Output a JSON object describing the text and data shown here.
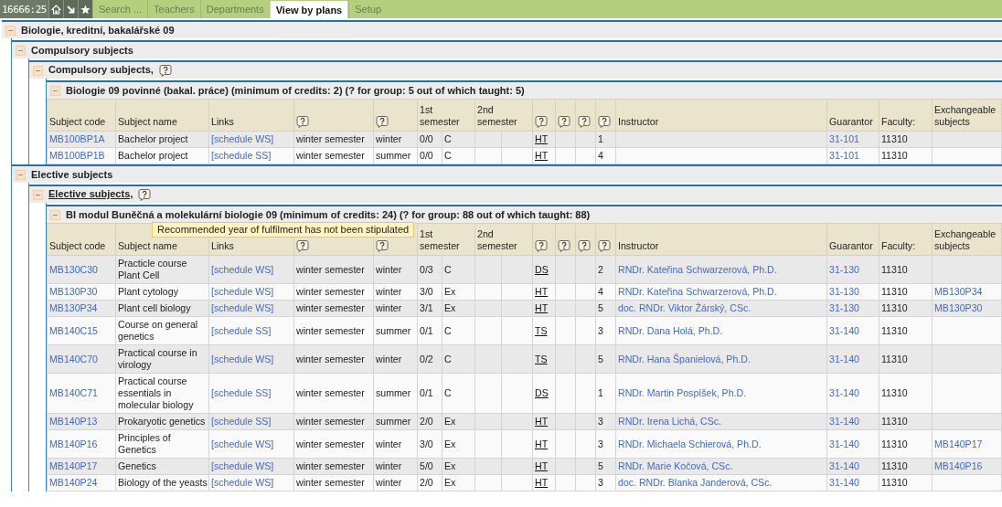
{
  "top_bar": {
    "counter": "16666:25",
    "tabs": [
      {
        "label": "Search ...",
        "selected": false
      },
      {
        "label": "Teachers",
        "selected": false
      },
      {
        "label": "Departments",
        "selected": false
      },
      {
        "label": "View by plans",
        "selected": true
      },
      {
        "label": "Setup",
        "selected": false
      }
    ]
  },
  "plan": {
    "title": "Biologie, kreditní, bakalářské 09",
    "expanded": true,
    "help": false,
    "hovered": false,
    "children": [
      {
        "title": "Compulsory subjects",
        "expanded": true,
        "help": false,
        "hovered": false,
        "children": [
          {
            "title": "Compulsory subjects,",
            "expanded": true,
            "help": true,
            "hovered": false,
            "children": [
              {
                "title": "Biologie 09 povinné (bakal. práce) (minimum of credits: 2) (? for group: 5 out of which taught: 5)",
                "expanded": true,
                "help": false,
                "hovered": false,
                "table": {
                  "columns": [
                    {
                      "kind": "text",
                      "label": "Subject code"
                    },
                    {
                      "kind": "text",
                      "label": "Subject name"
                    },
                    {
                      "kind": "text",
                      "label": "Links"
                    },
                    {
                      "kind": "help"
                    },
                    {
                      "kind": "help"
                    },
                    {
                      "kind": "pair",
                      "label": "1st semester"
                    },
                    {
                      "kind": "pair",
                      "label": "2nd semester"
                    },
                    {
                      "kind": "help"
                    },
                    {
                      "kind": "help"
                    },
                    {
                      "kind": "help"
                    },
                    {
                      "kind": "help"
                    },
                    {
                      "kind": "text",
                      "label": "Instructor"
                    },
                    {
                      "kind": "text",
                      "label": "Guarantor"
                    },
                    {
                      "kind": "text",
                      "label": "Faculty:"
                    },
                    {
                      "kind": "text",
                      "label": "Exchangeable subjects"
                    }
                  ],
                  "rows": [
                    {
                      "code": "MB100BP1A",
                      "name": "Bachelor project",
                      "links": "[schedule WS]",
                      "semester": "winter semester",
                      "period": "winter",
                      "hours": "0/0",
                      "completion": "C",
                      "type": "HT",
                      "year": "1",
                      "guarantor": "31-101",
                      "faculty": "11310"
                    },
                    {
                      "code": "MB100BP1B",
                      "name": "Bachelor project",
                      "links": "[schedule SS]",
                      "semester": "winter semester",
                      "period": "summer",
                      "hours": "0/0",
                      "completion": "C",
                      "type": "HT",
                      "year": "4",
                      "guarantor": "31-101",
                      "faculty": "11310"
                    }
                  ]
                }
              }
            ]
          }
        ]
      },
      {
        "title": "Elective subjects",
        "expanded": true,
        "help": false,
        "hovered": false,
        "children": [
          {
            "title": "Elective subjects,",
            "expanded": true,
            "help": true,
            "hovered": true,
            "children": [
              {
                "title": "BI modul Buněčná a molekulární biologie 09 (minimum of credits: 24) (? for group: 88 out of which taught: 88)",
                "expanded": true,
                "help": false,
                "hovered": false,
                "tooltip": "Recommended year of fulfilment has not been stipulated",
                "table": {
                  "columns": [
                    {
                      "kind": "text",
                      "label": "Subject code"
                    },
                    {
                      "kind": "text",
                      "label": "Subject name"
                    },
                    {
                      "kind": "text",
                      "label": "Links"
                    },
                    {
                      "kind": "help"
                    },
                    {
                      "kind": "help"
                    },
                    {
                      "kind": "pair",
                      "label": "1st semester"
                    },
                    {
                      "kind": "pair",
                      "label": "2nd semester"
                    },
                    {
                      "kind": "help"
                    },
                    {
                      "kind": "help"
                    },
                    {
                      "kind": "help"
                    },
                    {
                      "kind": "help"
                    },
                    {
                      "kind": "text",
                      "label": "Instructor"
                    },
                    {
                      "kind": "text",
                      "label": "Guarantor"
                    },
                    {
                      "kind": "text",
                      "label": "Faculty:"
                    },
                    {
                      "kind": "text",
                      "label": "Exchangeable subjects"
                    }
                  ],
                  "rows": [
                    {
                      "code": "MB130C30",
                      "name": "Practicle course Plant Cell",
                      "links": "[schedule WS]",
                      "semester": "winter semester",
                      "period": "winter",
                      "hours": "0/3",
                      "completion": "C",
                      "type": "DS",
                      "year": "2",
                      "instructor": "RNDr. Kateřina Schwarzerová, Ph.D.",
                      "guarantor": "31-130",
                      "faculty": "11310"
                    },
                    {
                      "code": "MB130P30",
                      "name": "Plant cytology",
                      "links": "[schedule WS]",
                      "semester": "winter semester",
                      "period": "winter",
                      "hours": "3/0",
                      "completion": "Ex",
                      "type": "HT",
                      "year": "4",
                      "instructor": "RNDr. Kateřina Schwarzerová, Ph.D.",
                      "guarantor": "31-130",
                      "faculty": "11310",
                      "exchangeable": "MB130P34"
                    },
                    {
                      "code": "MB130P34",
                      "name": "Plant cell biology",
                      "links": "[schedule WS]",
                      "semester": "winter semester",
                      "period": "winter",
                      "hours": "3/1",
                      "completion": "Ex",
                      "type": "HT",
                      "year": "5",
                      "instructor": "doc. RNDr. Viktor Žárský, CSc.",
                      "guarantor": "31-130",
                      "faculty": "11310",
                      "exchangeable": "MB130P30"
                    },
                    {
                      "code": "MB140C15",
                      "name": "Course on general genetics",
                      "links": "[schedule SS]",
                      "semester": "winter semester",
                      "period": "summer",
                      "hours": "0/1",
                      "completion": "C",
                      "type": "TS",
                      "year": "3",
                      "instructor": "RNDr. Dana Holá, Ph.D.",
                      "guarantor": "31-140",
                      "faculty": "11310"
                    },
                    {
                      "code": "MB140C70",
                      "name": "Practical course in virology",
                      "links": "[schedule WS]",
                      "semester": "winter semester",
                      "period": "winter",
                      "hours": "0/2",
                      "completion": "C",
                      "type": "TS",
                      "year": "5",
                      "instructor": "RNDr. Hana Španielová, Ph.D.",
                      "guarantor": "31-140",
                      "faculty": "11310"
                    },
                    {
                      "code": "MB140C71",
                      "name": "Practical course essentials in molecular biology",
                      "links": "[schedule SS]",
                      "semester": "winter semester",
                      "period": "summer",
                      "hours": "0/1",
                      "completion": "C",
                      "type": "DS",
                      "year": "1",
                      "instructor": "RNDr. Martin Pospíšek, Ph.D.",
                      "guarantor": "31-140",
                      "faculty": "11310"
                    },
                    {
                      "code": "MB140P13",
                      "name": "Prokaryotic genetics",
                      "links": "[schedule SS]",
                      "semester": "winter semester",
                      "period": "summer",
                      "hours": "2/0",
                      "completion": "Ex",
                      "type": "HT",
                      "year": "3",
                      "instructor": "RNDr. Irena Lichá, CSc.",
                      "guarantor": "31-140",
                      "faculty": "11310"
                    },
                    {
                      "code": "MB140P16",
                      "name": "Principles of Genetics",
                      "links": "[schedule WS]",
                      "semester": "winter semester",
                      "period": "winter",
                      "hours": "3/0",
                      "completion": "Ex",
                      "type": "HT",
                      "year": "3",
                      "instructor": "RNDr. Michaela Schierová, Ph.D.",
                      "guarantor": "31-140",
                      "faculty": "11310",
                      "exchangeable": "MB140P17"
                    },
                    {
                      "code": "MB140P17",
                      "name": "Genetics",
                      "links": "[schedule WS]",
                      "semester": "winter semester",
                      "period": "winter",
                      "hours": "5/0",
                      "completion": "Ex",
                      "type": "HT",
                      "year": "5",
                      "instructor": "RNDr. Marie Kočová, CSc.",
                      "guarantor": "31-140",
                      "faculty": "11310",
                      "exchangeable": "MB140P16"
                    },
                    {
                      "code": "MB140P24",
                      "name": "Biology of the yeasts",
                      "links": "[schedule WS]",
                      "semester": "winter semester",
                      "period": "winter",
                      "hours": "2/0",
                      "completion": "Ex",
                      "type": "HT",
                      "year": "3",
                      "instructor": "doc. RNDr. Blanka Janderová, CSc.",
                      "guarantor": "31-140",
                      "faculty": "11310"
                    }
                  ]
                }
              }
            ]
          }
        ]
      }
    ]
  }
}
